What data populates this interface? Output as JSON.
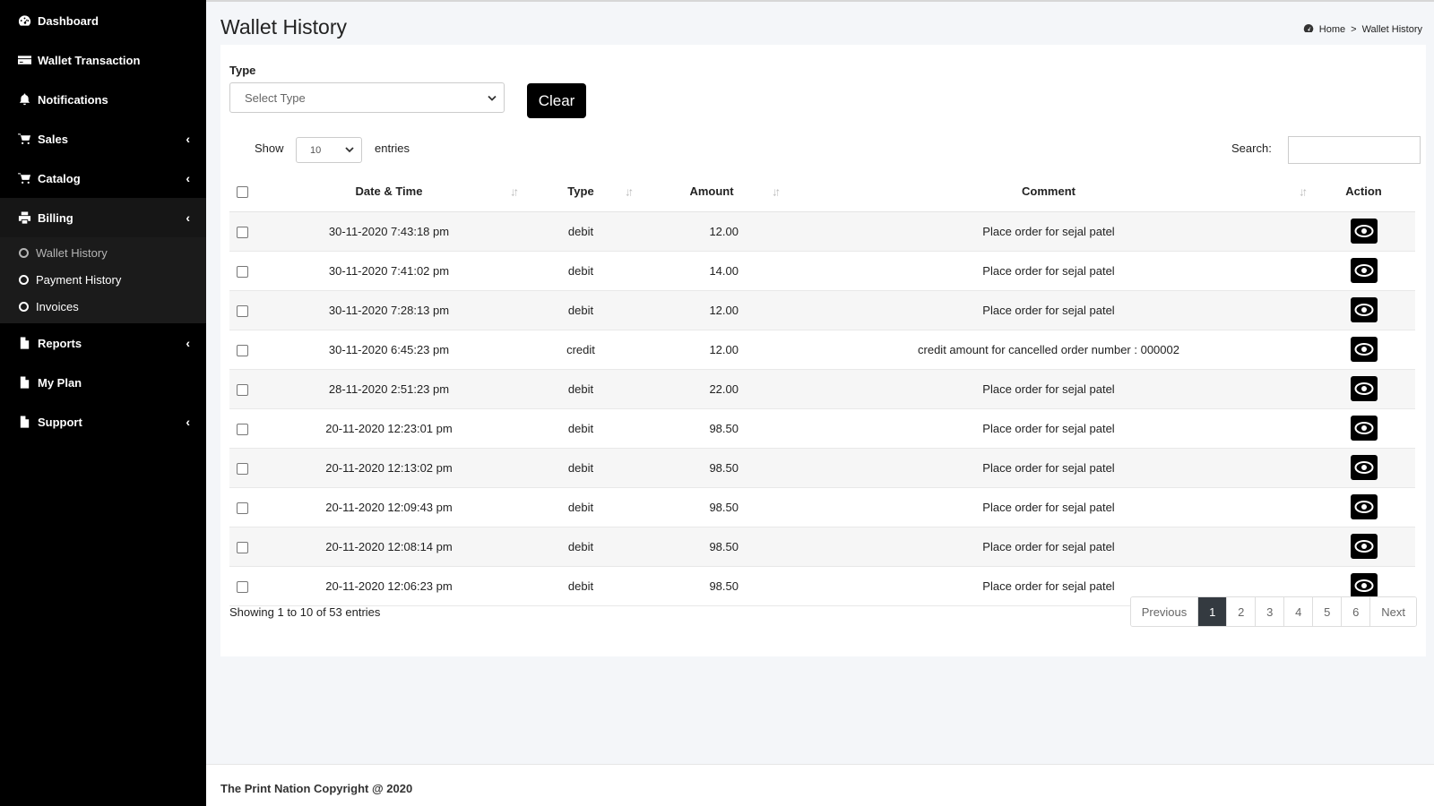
{
  "sidebar": {
    "items": [
      {
        "label": "Dashboard",
        "icon": "dashboard-icon"
      },
      {
        "label": "Wallet Transaction",
        "icon": "credit-card-icon"
      },
      {
        "label": "Notifications",
        "icon": "bell-icon"
      },
      {
        "label": "Sales",
        "icon": "cart-icon",
        "chevron": "‹"
      },
      {
        "label": "Catalog",
        "icon": "cart-icon",
        "chevron": "‹"
      },
      {
        "label": "Billing",
        "icon": "printer-icon",
        "chevron": "‹"
      },
      {
        "label": "Reports",
        "icon": "file-icon",
        "chevron": "‹"
      },
      {
        "label": "My Plan",
        "icon": "file-icon"
      },
      {
        "label": "Support",
        "icon": "file-icon",
        "chevron": "‹"
      }
    ],
    "billing_submenu": [
      "Wallet History",
      "Payment History",
      "Invoices"
    ]
  },
  "header": {
    "title": "Wallet History",
    "breadcrumb_home": "Home",
    "breadcrumb_sep": ">",
    "breadcrumb_current": "Wallet History"
  },
  "filter": {
    "type_label": "Type",
    "type_value": "Select Type",
    "clear_label": "Clear"
  },
  "table_controls": {
    "show_label": "Show",
    "page_length": "10",
    "entries_label": "entries",
    "search_label": "Search:"
  },
  "table": {
    "columns": [
      "Date & Time",
      "Type",
      "Amount",
      "Comment",
      "Action"
    ],
    "rows": [
      {
        "datetime": "30-11-2020 7:43:18 pm",
        "type": "debit",
        "amount": "12.00",
        "comment": "Place order for sejal patel"
      },
      {
        "datetime": "30-11-2020 7:41:02 pm",
        "type": "debit",
        "amount": "14.00",
        "comment": "Place order for sejal patel"
      },
      {
        "datetime": "30-11-2020 7:28:13 pm",
        "type": "debit",
        "amount": "12.00",
        "comment": "Place order for sejal patel"
      },
      {
        "datetime": "30-11-2020 6:45:23 pm",
        "type": "credit",
        "amount": "12.00",
        "comment": "credit amount for cancelled order number : 000002"
      },
      {
        "datetime": "28-11-2020 2:51:23 pm",
        "type": "debit",
        "amount": "22.00",
        "comment": "Place order for sejal patel"
      },
      {
        "datetime": "20-11-2020 12:23:01 pm",
        "type": "debit",
        "amount": "98.50",
        "comment": "Place order for sejal patel"
      },
      {
        "datetime": "20-11-2020 12:13:02 pm",
        "type": "debit",
        "amount": "98.50",
        "comment": "Place order for sejal patel"
      },
      {
        "datetime": "20-11-2020 12:09:43 pm",
        "type": "debit",
        "amount": "98.50",
        "comment": "Place order for sejal patel"
      },
      {
        "datetime": "20-11-2020 12:08:14 pm",
        "type": "debit",
        "amount": "98.50",
        "comment": "Place order for sejal patel"
      },
      {
        "datetime": "20-11-2020 12:06:23 pm",
        "type": "debit",
        "amount": "98.50",
        "comment": "Place order for sejal patel"
      }
    ]
  },
  "pagination": {
    "info": "Showing 1 to 10 of 53 entries",
    "previous": "Previous",
    "pages": [
      "1",
      "2",
      "3",
      "4",
      "5",
      "6"
    ],
    "current": "1",
    "next": "Next"
  },
  "footer": {
    "text": "The Print Nation Copyright @ 2020"
  }
}
